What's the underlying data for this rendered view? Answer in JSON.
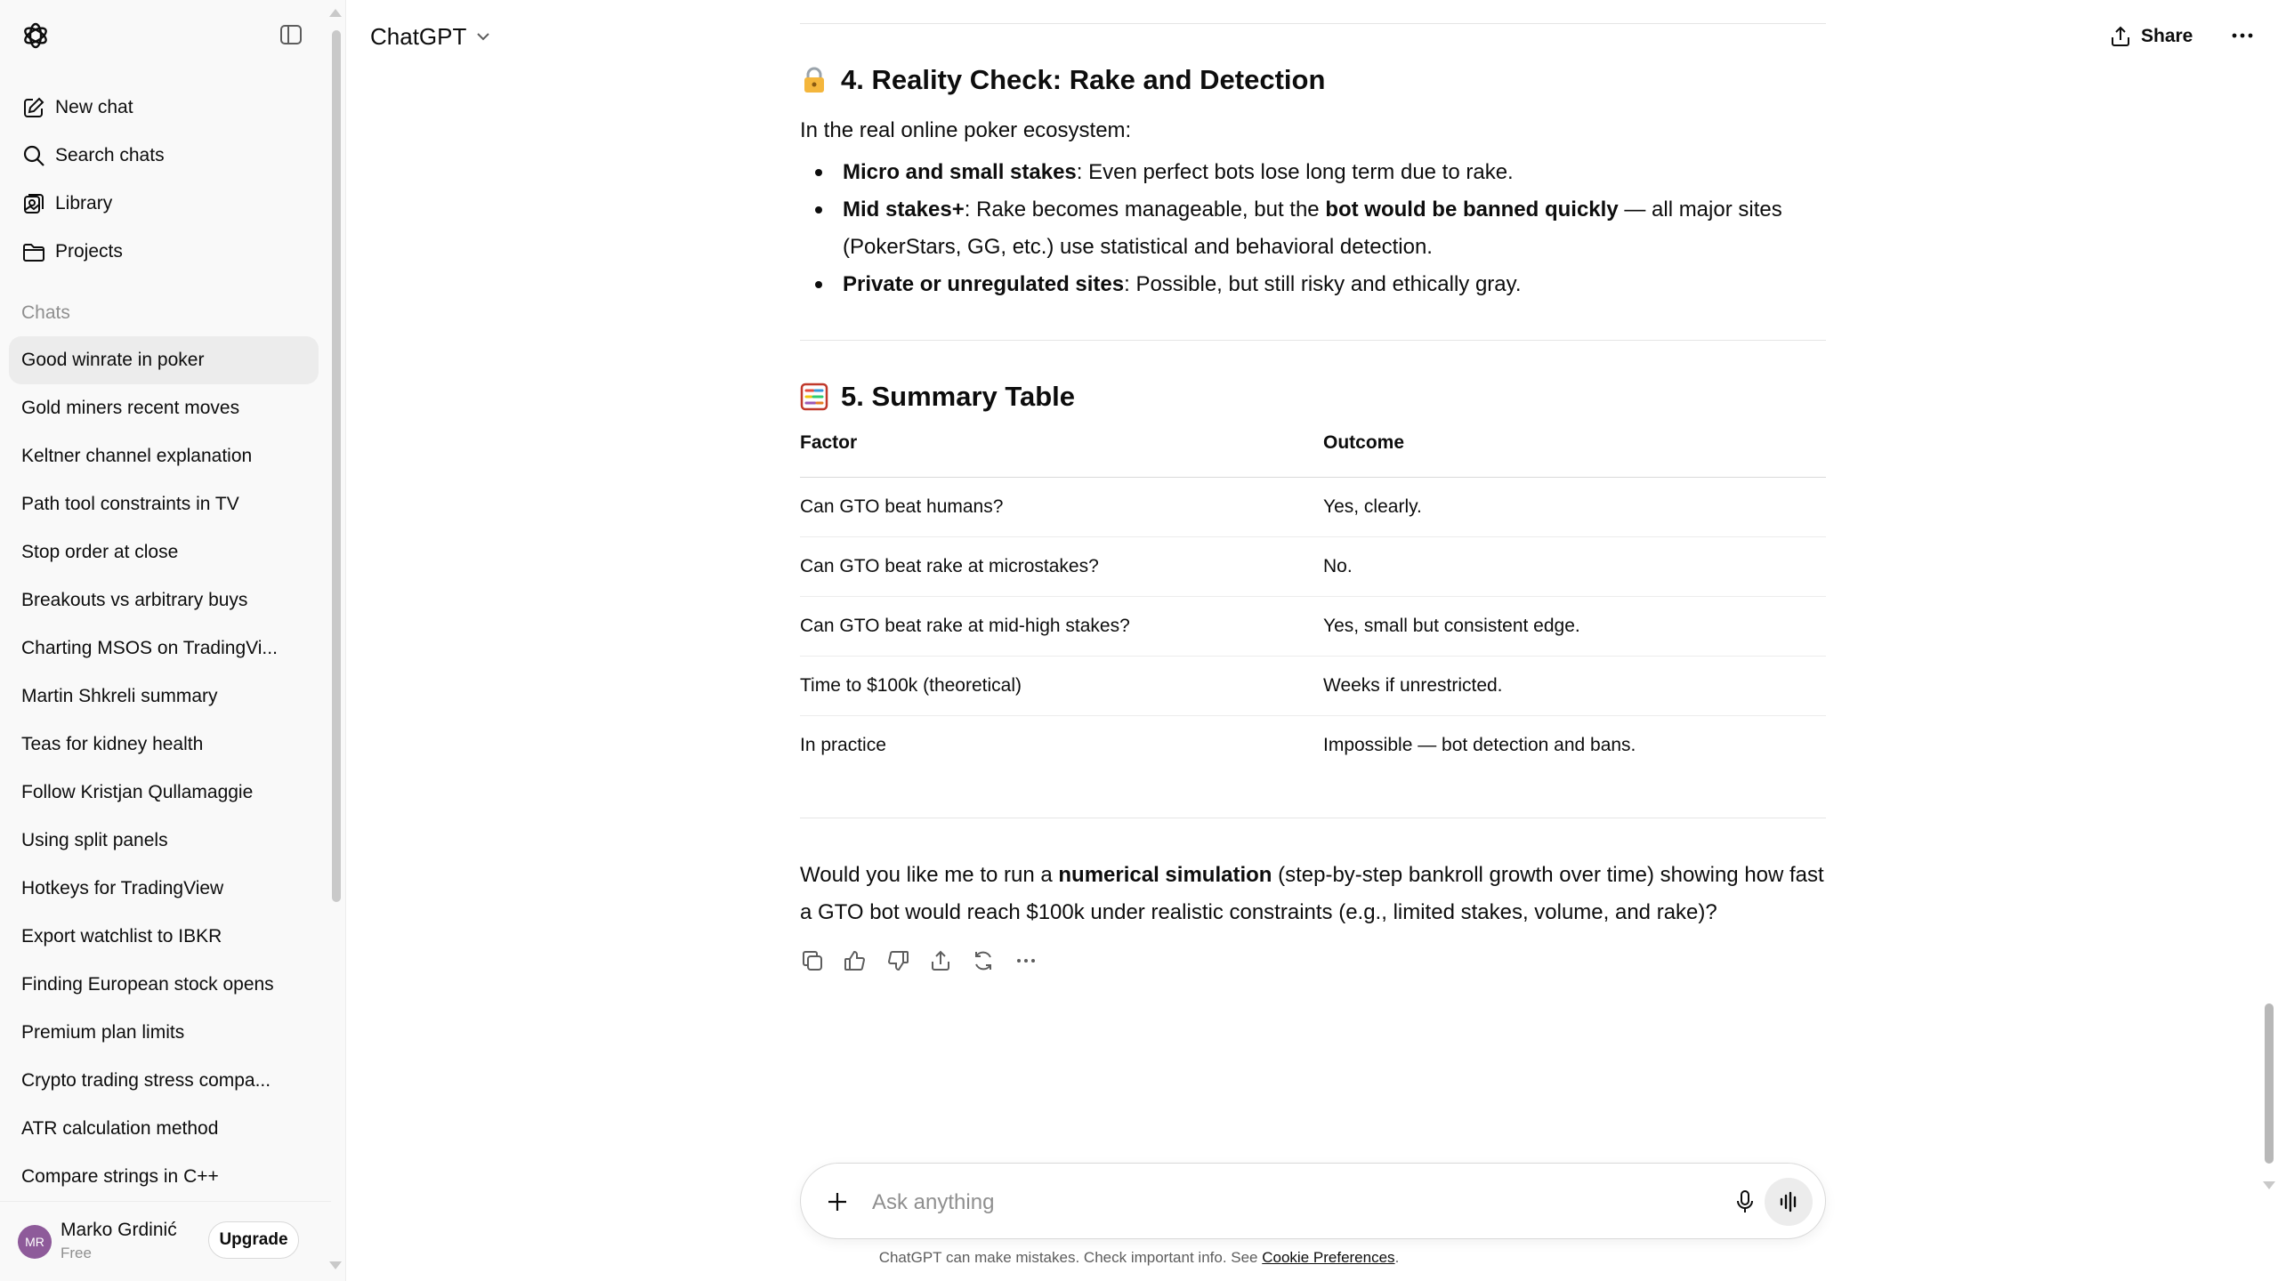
{
  "app": {
    "model_label": "ChatGPT"
  },
  "sidebar": {
    "nav": [
      {
        "label": "New chat",
        "icon": "pencil-square-icon"
      },
      {
        "label": "Search chats",
        "icon": "search-icon"
      },
      {
        "label": "Library",
        "icon": "library-icon"
      },
      {
        "label": "Projects",
        "icon": "folder-icon"
      }
    ],
    "chats_label": "Chats",
    "chats": [
      "Good winrate in poker",
      "Gold miners recent moves",
      "Keltner channel explanation",
      "Path tool constraints in TV",
      "Stop order at close",
      "Breakouts vs arbitrary buys",
      "Charting MSOS on TradingVi...",
      "Martin Shkreli summary",
      "Teas for kidney health",
      "Follow Kristjan Qullamaggie",
      "Using split panels",
      "Hotkeys for TradingView",
      "Export watchlist to IBKR",
      "Finding European stock opens",
      "Premium plan limits",
      "Crypto trading stress compa...",
      "ATR calculation method",
      "Compare strings in C++"
    ],
    "active_chat_index": 0,
    "user": {
      "initials": "MR",
      "name": "Marko Grdinić",
      "plan": "Free",
      "upgrade_label": "Upgrade"
    }
  },
  "header": {
    "share_label": "Share"
  },
  "conversation": {
    "section4": {
      "emoji": "lock",
      "title": "4. Reality Check: Rake and Detection",
      "intro": "In the real online poker ecosystem:",
      "bullets": [
        {
          "bold": "Micro and small stakes",
          "text": ": Even perfect bots lose long term due to rake."
        },
        {
          "bold": "Mid stakes+",
          "text": ": Rake becomes manageable, but the ",
          "bold2": "bot would be banned quickly",
          "text2": " — all major sites (PokerStars, GG, etc.) use statistical and behavioral detection."
        },
        {
          "bold": "Private or unregulated sites",
          "text": ": Possible, but still risky and ethically gray."
        }
      ]
    },
    "section5": {
      "emoji": "abacus",
      "title": "5. Summary Table",
      "columns": [
        "Factor",
        "Outcome"
      ],
      "rows": [
        [
          "Can GTO beat humans?",
          "Yes, clearly."
        ],
        [
          "Can GTO beat rake at microstakes?",
          "No."
        ],
        [
          "Can GTO beat rake at mid-high stakes?",
          "Yes, small but consistent edge."
        ],
        [
          "Time to $100k (theoretical)",
          "Weeks if unrestricted."
        ],
        [
          "In practice",
          "Impossible — bot detection and bans."
        ]
      ]
    },
    "closing": {
      "pre": "Would you like me to run a ",
      "bold": "numerical simulation",
      "post": " (step-by-step bankroll growth over time) showing how fast a GTO bot would reach $100k under realistic constraints (e.g., limited stakes, volume, and rake)?"
    }
  },
  "composer": {
    "placeholder": "Ask anything",
    "footnote_text": "ChatGPT can make mistakes. Check important info. See ",
    "footnote_link": "Cookie Preferences",
    "footnote_end": "."
  }
}
